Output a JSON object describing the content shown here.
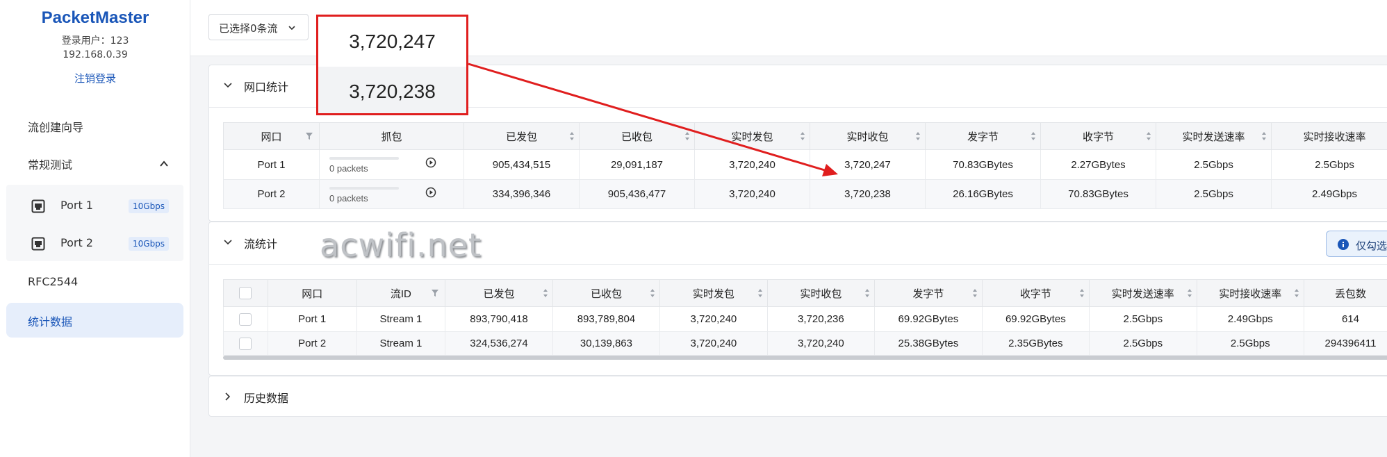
{
  "sidebar": {
    "brand": "PacketMaster",
    "login_user": "登录用户：123",
    "login_ip": "192.168.0.39",
    "logout": "注销登录",
    "nav": {
      "wizard": "流创建向导",
      "regular_test": "常规测试",
      "ports": [
        {
          "label": "Port 1",
          "speed": "10Gbps"
        },
        {
          "label": "Port 2",
          "speed": "10Gbps"
        }
      ],
      "rfc2544": "RFC2544",
      "stats": "统计数据"
    }
  },
  "topbar": {
    "select_label": "已选择0条流"
  },
  "port_stats": {
    "title": "网口统计",
    "headers": [
      "网口",
      "抓包",
      "已发包",
      "已收包",
      "实时发包",
      "实时收包",
      "发字节",
      "收字节",
      "实时发送速率",
      "实时接收速率"
    ],
    "rows": [
      {
        "port": "Port 1",
        "capture": "0 packets",
        "sent": "905,434,515",
        "recv": "29,091,187",
        "rt_sent": "3,720,240",
        "rt_recv": "3,720,247",
        "tx_bytes": "70.83GBytes",
        "rx_bytes": "2.27GBytes",
        "tx_rate": "2.5Gbps",
        "rx_rate": "2.5Gbps"
      },
      {
        "port": "Port 2",
        "capture": "0 packets",
        "sent": "334,396,346",
        "recv": "905,436,477",
        "rt_sent": "3,720,240",
        "rt_recv": "3,720,238",
        "tx_bytes": "26.16GBytes",
        "rx_bytes": "70.83GBytes",
        "tx_rate": "2.5Gbps",
        "rx_rate": "2.49Gbps"
      }
    ]
  },
  "flow_stats": {
    "title": "流统计",
    "info_label": "仅勾选",
    "headers": [
      "网口",
      "流ID",
      "已发包",
      "已收包",
      "实时发包",
      "实时收包",
      "发字节",
      "收字节",
      "实时发送速率",
      "实时接收速率",
      "丢包数"
    ],
    "rows": [
      {
        "port": "Port 1",
        "stream": "Stream 1",
        "sent": "893,790,418",
        "recv": "893,789,804",
        "rt_sent": "3,720,240",
        "rt_recv": "3,720,236",
        "tx_bytes": "69.92GBytes",
        "rx_bytes": "69.92GBytes",
        "tx_rate": "2.5Gbps",
        "rx_rate": "2.49Gbps",
        "loss": "614"
      },
      {
        "port": "Port 2",
        "stream": "Stream 1",
        "sent": "324,536,274",
        "recv": "30,139,863",
        "rt_sent": "3,720,240",
        "rt_recv": "3,720,240",
        "tx_bytes": "25.38GBytes",
        "rx_bytes": "2.35GBytes",
        "tx_rate": "2.5Gbps",
        "rx_rate": "2.5Gbps",
        "loss": "294396411"
      }
    ]
  },
  "history": {
    "title": "历史数据"
  },
  "callout": {
    "value_1": "3,720,247",
    "value_2": "3,720,238"
  },
  "watermark": "acwifi.net",
  "colors": {
    "accent": "#1a56b8",
    "annotation": "#e01e1e",
    "active_bg": "#e6eefb"
  }
}
